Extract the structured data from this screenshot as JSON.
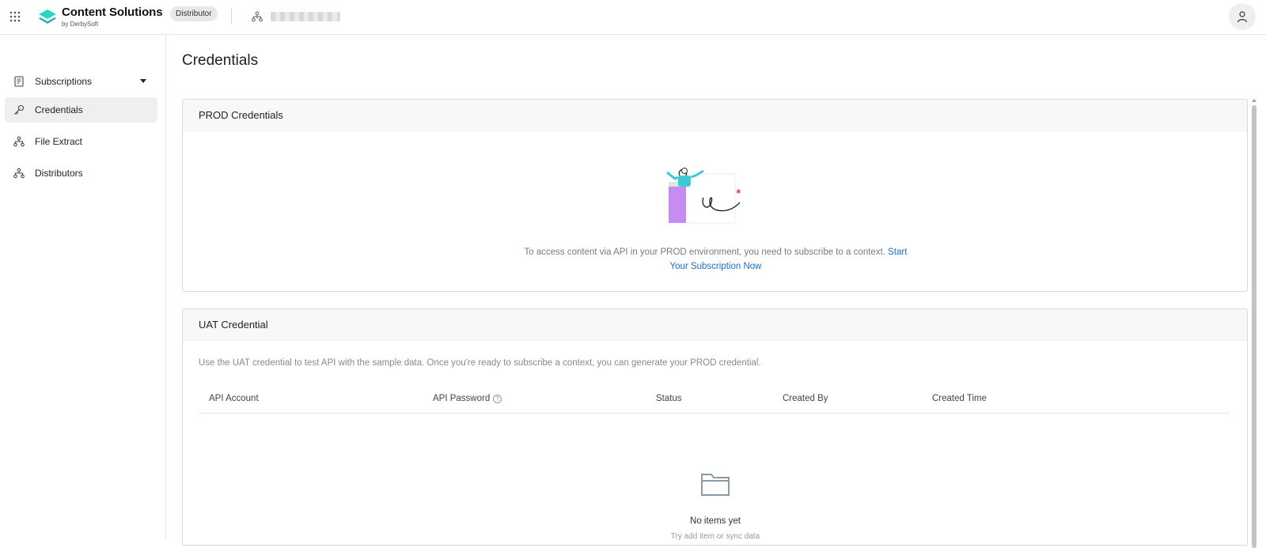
{
  "header": {
    "brand_title": "Content Solutions",
    "brand_subtitle": "by DerbySoft",
    "role_badge": "Distributor",
    "brand_color": "#2ed3c8"
  },
  "sidebar": {
    "items": [
      {
        "label": "Subscriptions",
        "icon": "document-list-icon",
        "has_dropdown": true
      },
      {
        "label": "Credentials",
        "icon": "key-icon",
        "active": true
      },
      {
        "label": "File Extract",
        "icon": "hierarchy-icon"
      },
      {
        "label": "Distributors",
        "icon": "hierarchy-icon"
      }
    ]
  },
  "main": {
    "page_title": "Credentials",
    "prod": {
      "title": "PROD Credentials",
      "message": "To access content via API in your PROD environment, you need to subscribe to a context.",
      "link_text": "Start Your Subscription Now"
    },
    "uat": {
      "title": "UAT Credential",
      "description": "Use the UAT credential to test API with the sample data. Once you're ready to subscribe a context, you can generate your PROD credential.",
      "columns": [
        "API Account",
        "API Password",
        "Status",
        "Created By",
        "Created Time"
      ],
      "empty_title": "No items yet",
      "empty_subtitle": "Try add item or sync data"
    }
  },
  "colors": {
    "link": "#1a6fd1",
    "active_nav_bg": "#efefef"
  }
}
